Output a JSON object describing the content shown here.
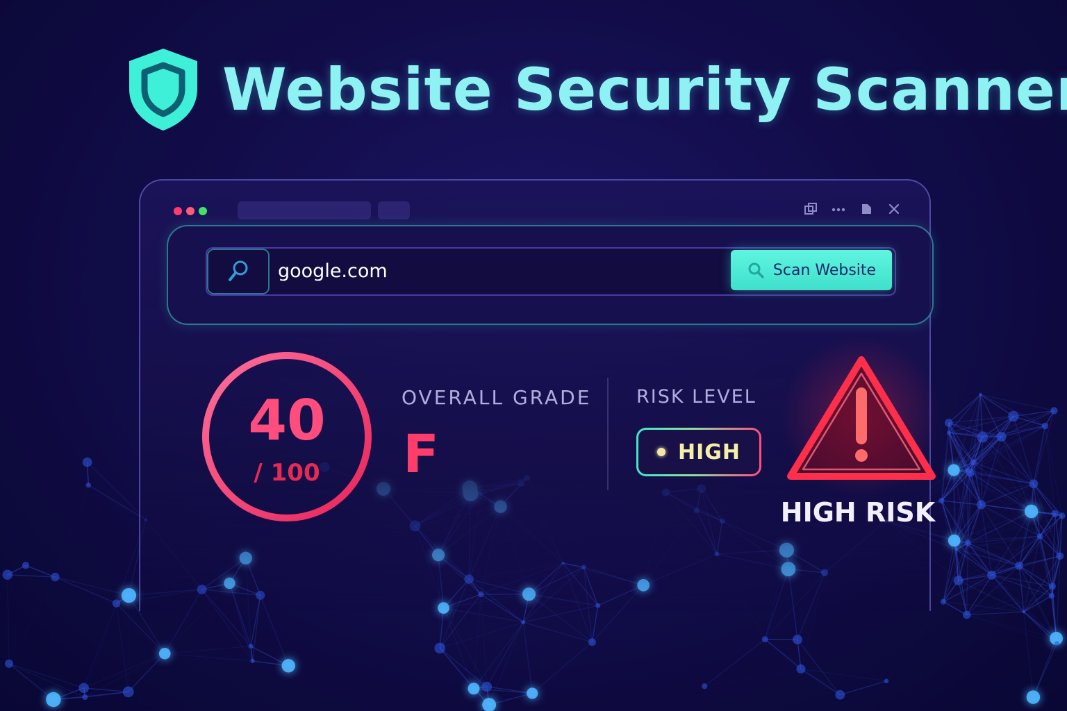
{
  "app": {
    "title": "Website Security Scanner"
  },
  "search": {
    "url_value": "google.com",
    "scan_button_label": "Scan Website"
  },
  "score": {
    "value": "40",
    "max_label": "/ 100",
    "fraction": 0.4
  },
  "grade": {
    "label": "OVERALL GRADE",
    "value": "F"
  },
  "risk": {
    "label": "RISK LEVEL",
    "badge": "HIGH",
    "alert_text": "HIGH RISK"
  },
  "colors": {
    "accent_teal": "#5ff5e0",
    "score_pink": "#ff4d7d",
    "danger_red": "#ff2e4a",
    "background": "#120d4a"
  },
  "icons": {
    "logo": "shield-icon",
    "search": "search-icon",
    "scan": "magnifier-icon",
    "alert": "warning-icon",
    "window_controls": [
      "restore-icon",
      "more-icon",
      "page-icon",
      "close-icon"
    ]
  }
}
